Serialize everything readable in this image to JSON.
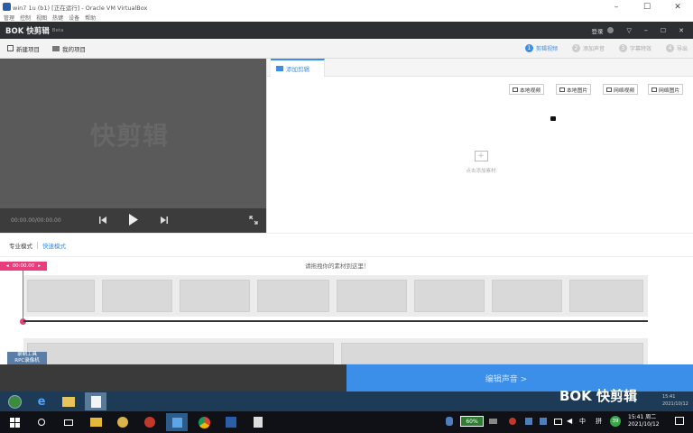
{
  "host_window": {
    "title": "win7 1u (b1) [正在运行] - Oracle VM VirtualBox",
    "menu": [
      "管理",
      "控制",
      "视图",
      "热键",
      "设备",
      "帮助"
    ],
    "controls": [
      "–",
      "☐",
      "✕"
    ]
  },
  "app": {
    "logo": "BOK 快剪辑",
    "beta": "Beta",
    "login": "登录",
    "window_controls": [
      "▽",
      "–",
      "☐",
      "✕"
    ]
  },
  "toolbar": {
    "new_project": "新建项目",
    "open_project": "我的项目",
    "steps": [
      {
        "num": "1",
        "label": "剪辑视频",
        "active": true
      },
      {
        "num": "2",
        "label": "添加声音",
        "active": false
      },
      {
        "num": "3",
        "label": "字幕特效",
        "active": false
      },
      {
        "num": "4",
        "label": "导出",
        "active": false
      }
    ]
  },
  "preview": {
    "watermark": "快剪辑",
    "time": "00:00.00/00:00.00"
  },
  "panel": {
    "tab": "添加剪辑",
    "import_buttons": [
      "本地视频",
      "本地图片",
      "网络视频",
      "网络图片"
    ],
    "empty_text": "点击添加素材"
  },
  "modes": {
    "pro": "专业模式",
    "fast": "快速模式"
  },
  "timeline": {
    "playhead_time": "00:00.00",
    "hint": "请拖拽你的素材到这里！"
  },
  "bottom": {
    "left_lines": [
      "录制工具",
      "RPC录像机"
    ],
    "next_button": "编辑声音 >"
  },
  "guest_tray": {
    "watermark": "BOK 快剪辑",
    "time": "15:41",
    "date": "2021/10/12"
  },
  "host_tray": {
    "battery": "60%",
    "ime": "中",
    "lang": "拼",
    "time": "15:41 周二",
    "date": "2021/10/12",
    "badge": "39"
  },
  "colors": {
    "accent": "#3b8fe8",
    "pink": "#e83e7c",
    "header": "#2d2f33"
  }
}
